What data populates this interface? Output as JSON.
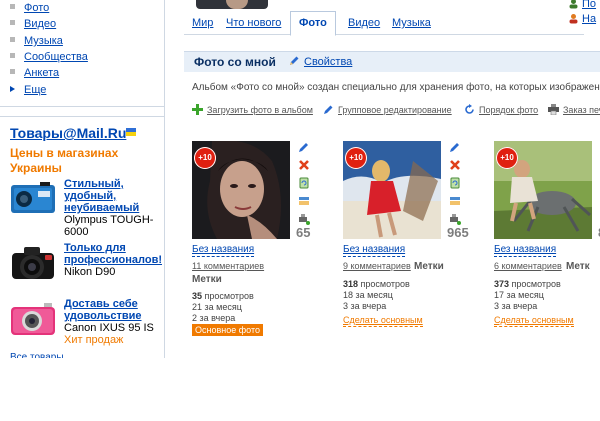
{
  "sidebar": {
    "nav": [
      {
        "label": "Фото",
        "type": "bullet"
      },
      {
        "label": "Видео",
        "type": "bullet"
      },
      {
        "label": "Музыка",
        "type": "bullet"
      },
      {
        "label": "Сообщества",
        "type": "bullet"
      },
      {
        "label": "Анкета",
        "type": "bullet"
      },
      {
        "label": "Еще",
        "type": "arrow"
      }
    ],
    "shop": {
      "title": "Товары@Mail.Ru",
      "subtitle": "Цены в магазинах Украины",
      "products": [
        {
          "title": "Стильный, удобный, неубиваемый",
          "model": "Olympus TOUGH-6000",
          "tag": "",
          "icon": "compact-camera-blue"
        },
        {
          "title": "Только для профессионалов!",
          "model": "Nikon D90",
          "tag": "",
          "icon": "dslr-camera-black"
        },
        {
          "title": "Доставь себе удовольствие",
          "model": "Canon IXUS 95 IS",
          "tag": "Хит продаж",
          "icon": "compact-camera-pink"
        }
      ],
      "all_link": "Все товары"
    }
  },
  "tabs": [
    {
      "label": "Мир",
      "active": false
    },
    {
      "label": "Что нового",
      "active": false
    },
    {
      "label": "Фото",
      "active": true
    },
    {
      "label": "Видео",
      "active": false
    },
    {
      "label": "Музыка",
      "active": false
    }
  ],
  "right_links": [
    {
      "label": "По",
      "icon": "user-icon"
    },
    {
      "label": "На",
      "icon": "person-icon"
    }
  ],
  "album": {
    "title": "Фото со мной",
    "properties_label": "Свойства",
    "description": "Альбом «Фото со мной» создан специально для хранения фото, на которых изображен"
  },
  "toolbar": {
    "upload": "Загрузить фото в альбом",
    "group_edit": "Групповое редактирование",
    "order": "Порядок фото",
    "print_order": "Заказ печ"
  },
  "photos": [
    {
      "badge": "+10",
      "count": "65",
      "title": "Без названия",
      "comments": "11 комментариев",
      "tags": "Метки",
      "tags_inline": false,
      "views": "35",
      "views_label": "просмотров",
      "month": "21 за месяц",
      "yesterday": "2 за вчера",
      "action": "Основное фото",
      "is_main": true
    },
    {
      "badge": "+10",
      "count": "965",
      "title": "Без названия",
      "comments": "9 комментариев",
      "tags": "Метки",
      "tags_inline": true,
      "views": "318",
      "views_label": "просмотров",
      "month": "18 за месяц",
      "yesterday": "3 за вчера",
      "action": "Сделать основным",
      "is_main": false
    },
    {
      "badge": "+10",
      "count": "8",
      "title": "Без названия",
      "comments": "6 комментариев",
      "tags": "Метк",
      "tags_inline": true,
      "views": "373",
      "views_label": "просмотров",
      "month": "17 за месяц",
      "yesterday": "3 за вчера",
      "action": "Сделать основным",
      "is_main": false
    }
  ],
  "colors": {
    "link": "#0047b2",
    "accent": "#f07a00",
    "album_bar": "#e7eff8",
    "badge": "#e02010"
  }
}
